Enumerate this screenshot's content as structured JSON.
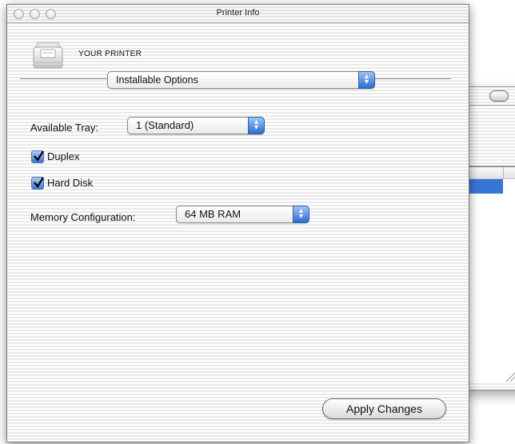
{
  "window": {
    "title": "Printer Info"
  },
  "printer": {
    "name": "YOUR PRINTER",
    "icon": "printer-icon"
  },
  "view_popup": {
    "selected": "Installable Options"
  },
  "tray": {
    "label": "Available Tray:",
    "selected": "1 (Standard)"
  },
  "options": [
    {
      "label": "Duplex",
      "checked": true
    },
    {
      "label": "Hard Disk",
      "checked": true
    }
  ],
  "memory": {
    "label": "Memory Configuration:",
    "selected": "64 MB RAM"
  },
  "apply_label": "Apply Changes",
  "colors": {
    "accent": "#3875d7",
    "stepper": "#2d6bd3"
  }
}
